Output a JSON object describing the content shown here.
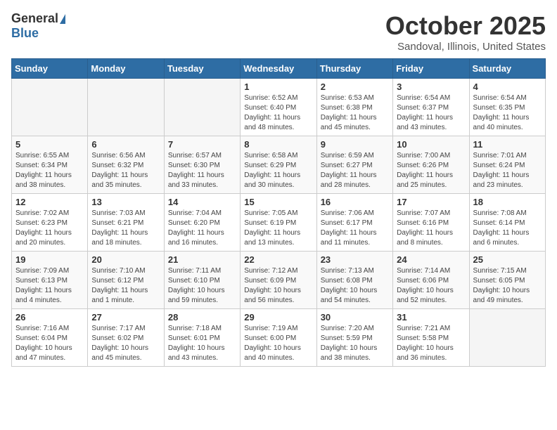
{
  "header": {
    "logo_general": "General",
    "logo_blue": "Blue",
    "title": "October 2025",
    "location": "Sandoval, Illinois, United States"
  },
  "days_of_week": [
    "Sunday",
    "Monday",
    "Tuesday",
    "Wednesday",
    "Thursday",
    "Friday",
    "Saturday"
  ],
  "weeks": [
    [
      {
        "day": "",
        "info": ""
      },
      {
        "day": "",
        "info": ""
      },
      {
        "day": "",
        "info": ""
      },
      {
        "day": "1",
        "info": "Sunrise: 6:52 AM\nSunset: 6:40 PM\nDaylight: 11 hours and 48 minutes."
      },
      {
        "day": "2",
        "info": "Sunrise: 6:53 AM\nSunset: 6:38 PM\nDaylight: 11 hours and 45 minutes."
      },
      {
        "day": "3",
        "info": "Sunrise: 6:54 AM\nSunset: 6:37 PM\nDaylight: 11 hours and 43 minutes."
      },
      {
        "day": "4",
        "info": "Sunrise: 6:54 AM\nSunset: 6:35 PM\nDaylight: 11 hours and 40 minutes."
      }
    ],
    [
      {
        "day": "5",
        "info": "Sunrise: 6:55 AM\nSunset: 6:34 PM\nDaylight: 11 hours and 38 minutes."
      },
      {
        "day": "6",
        "info": "Sunrise: 6:56 AM\nSunset: 6:32 PM\nDaylight: 11 hours and 35 minutes."
      },
      {
        "day": "7",
        "info": "Sunrise: 6:57 AM\nSunset: 6:30 PM\nDaylight: 11 hours and 33 minutes."
      },
      {
        "day": "8",
        "info": "Sunrise: 6:58 AM\nSunset: 6:29 PM\nDaylight: 11 hours and 30 minutes."
      },
      {
        "day": "9",
        "info": "Sunrise: 6:59 AM\nSunset: 6:27 PM\nDaylight: 11 hours and 28 minutes."
      },
      {
        "day": "10",
        "info": "Sunrise: 7:00 AM\nSunset: 6:26 PM\nDaylight: 11 hours and 25 minutes."
      },
      {
        "day": "11",
        "info": "Sunrise: 7:01 AM\nSunset: 6:24 PM\nDaylight: 11 hours and 23 minutes."
      }
    ],
    [
      {
        "day": "12",
        "info": "Sunrise: 7:02 AM\nSunset: 6:23 PM\nDaylight: 11 hours and 20 minutes."
      },
      {
        "day": "13",
        "info": "Sunrise: 7:03 AM\nSunset: 6:21 PM\nDaylight: 11 hours and 18 minutes."
      },
      {
        "day": "14",
        "info": "Sunrise: 7:04 AM\nSunset: 6:20 PM\nDaylight: 11 hours and 16 minutes."
      },
      {
        "day": "15",
        "info": "Sunrise: 7:05 AM\nSunset: 6:19 PM\nDaylight: 11 hours and 13 minutes."
      },
      {
        "day": "16",
        "info": "Sunrise: 7:06 AM\nSunset: 6:17 PM\nDaylight: 11 hours and 11 minutes."
      },
      {
        "day": "17",
        "info": "Sunrise: 7:07 AM\nSunset: 6:16 PM\nDaylight: 11 hours and 8 minutes."
      },
      {
        "day": "18",
        "info": "Sunrise: 7:08 AM\nSunset: 6:14 PM\nDaylight: 11 hours and 6 minutes."
      }
    ],
    [
      {
        "day": "19",
        "info": "Sunrise: 7:09 AM\nSunset: 6:13 PM\nDaylight: 11 hours and 4 minutes."
      },
      {
        "day": "20",
        "info": "Sunrise: 7:10 AM\nSunset: 6:12 PM\nDaylight: 11 hours and 1 minute."
      },
      {
        "day": "21",
        "info": "Sunrise: 7:11 AM\nSunset: 6:10 PM\nDaylight: 10 hours and 59 minutes."
      },
      {
        "day": "22",
        "info": "Sunrise: 7:12 AM\nSunset: 6:09 PM\nDaylight: 10 hours and 56 minutes."
      },
      {
        "day": "23",
        "info": "Sunrise: 7:13 AM\nSunset: 6:08 PM\nDaylight: 10 hours and 54 minutes."
      },
      {
        "day": "24",
        "info": "Sunrise: 7:14 AM\nSunset: 6:06 PM\nDaylight: 10 hours and 52 minutes."
      },
      {
        "day": "25",
        "info": "Sunrise: 7:15 AM\nSunset: 6:05 PM\nDaylight: 10 hours and 49 minutes."
      }
    ],
    [
      {
        "day": "26",
        "info": "Sunrise: 7:16 AM\nSunset: 6:04 PM\nDaylight: 10 hours and 47 minutes."
      },
      {
        "day": "27",
        "info": "Sunrise: 7:17 AM\nSunset: 6:02 PM\nDaylight: 10 hours and 45 minutes."
      },
      {
        "day": "28",
        "info": "Sunrise: 7:18 AM\nSunset: 6:01 PM\nDaylight: 10 hours and 43 minutes."
      },
      {
        "day": "29",
        "info": "Sunrise: 7:19 AM\nSunset: 6:00 PM\nDaylight: 10 hours and 40 minutes."
      },
      {
        "day": "30",
        "info": "Sunrise: 7:20 AM\nSunset: 5:59 PM\nDaylight: 10 hours and 38 minutes."
      },
      {
        "day": "31",
        "info": "Sunrise: 7:21 AM\nSunset: 5:58 PM\nDaylight: 10 hours and 36 minutes."
      },
      {
        "day": "",
        "info": ""
      }
    ]
  ]
}
